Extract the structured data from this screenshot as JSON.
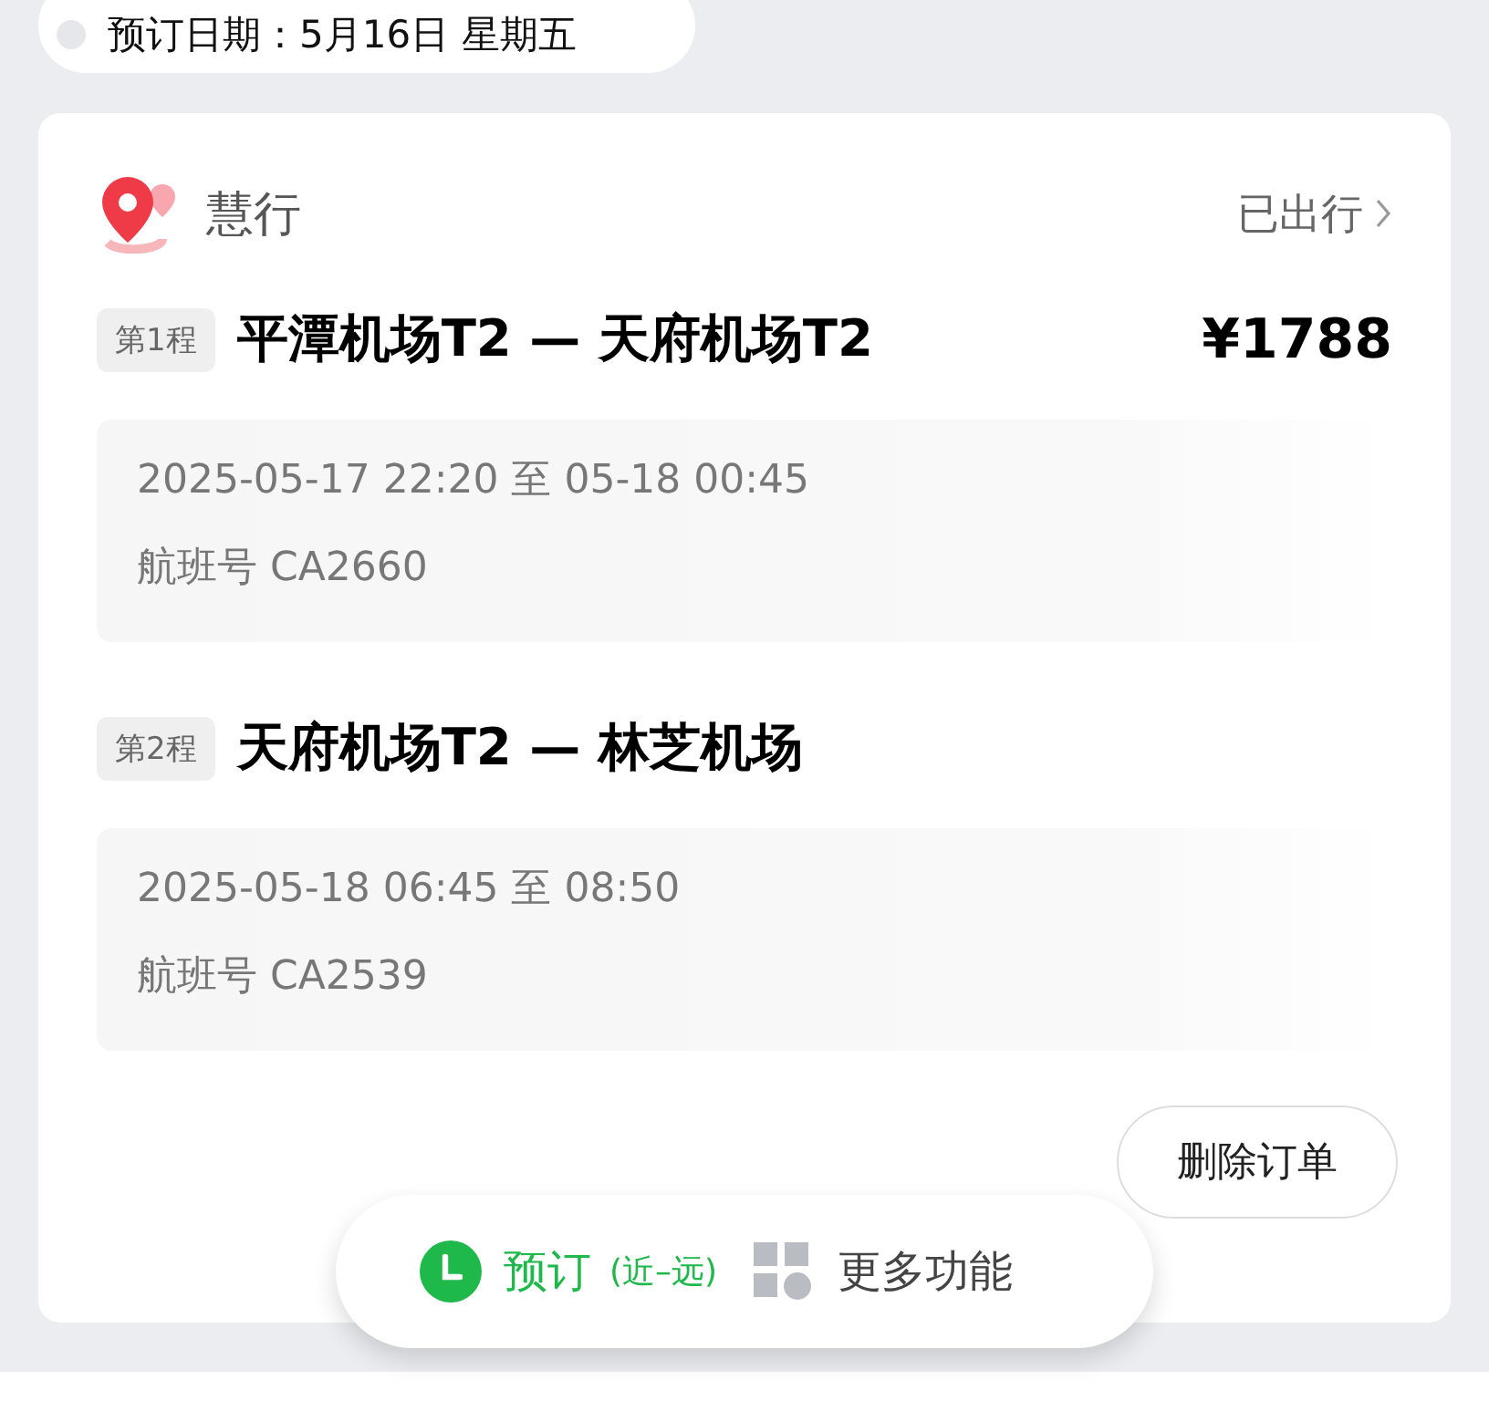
{
  "date_pill": {
    "text": "预订日期：5月16日 星期五"
  },
  "order": {
    "brand": "慧行",
    "status": "已出行",
    "price": "¥1788",
    "legs": [
      {
        "label": "第1程",
        "route": "平潭机场T2 — 天府机场T2",
        "time": "2025-05-17 22:20 至 05-18 00:45",
        "flight": "航班号 CA2660"
      },
      {
        "label": "第2程",
        "route": "天府机场T2 — 林芝机场",
        "time": "2025-05-18 06:45 至 08:50",
        "flight": "航班号 CA2539"
      }
    ],
    "delete_button": "删除订单"
  },
  "bottom_bar": {
    "sort_label": "预订",
    "sort_order": "(近–远)",
    "more": "更多功能"
  }
}
